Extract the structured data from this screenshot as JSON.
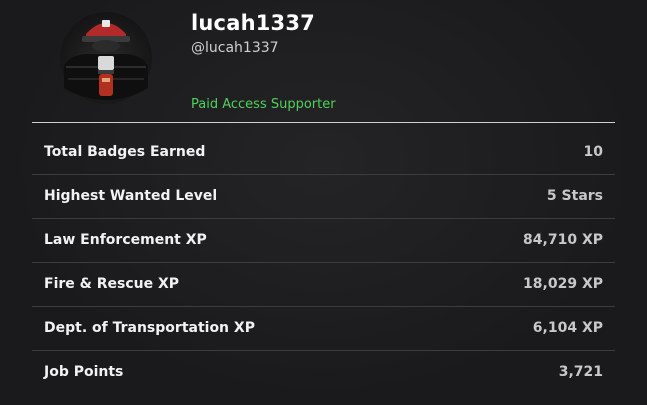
{
  "profile": {
    "display_name": "lucah1337",
    "handle": "@lucah1337",
    "tag": "Paid Access Supporter"
  },
  "colors": {
    "tag": "#4fd15a",
    "row_divider": "#3c3c3f",
    "header_divider": "#cfcfcf"
  },
  "stats": [
    {
      "label": "Total Badges Earned",
      "value": "10"
    },
    {
      "label": "Highest Wanted Level",
      "value": "5 Stars"
    },
    {
      "label": "Law Enforcement XP",
      "value": "84,710 XP"
    },
    {
      "label": "Fire & Rescue XP",
      "value": "18,029 XP"
    },
    {
      "label": "Dept. of Transportation XP",
      "value": "6,104 XP"
    },
    {
      "label": "Job Points",
      "value": "3,721"
    }
  ]
}
